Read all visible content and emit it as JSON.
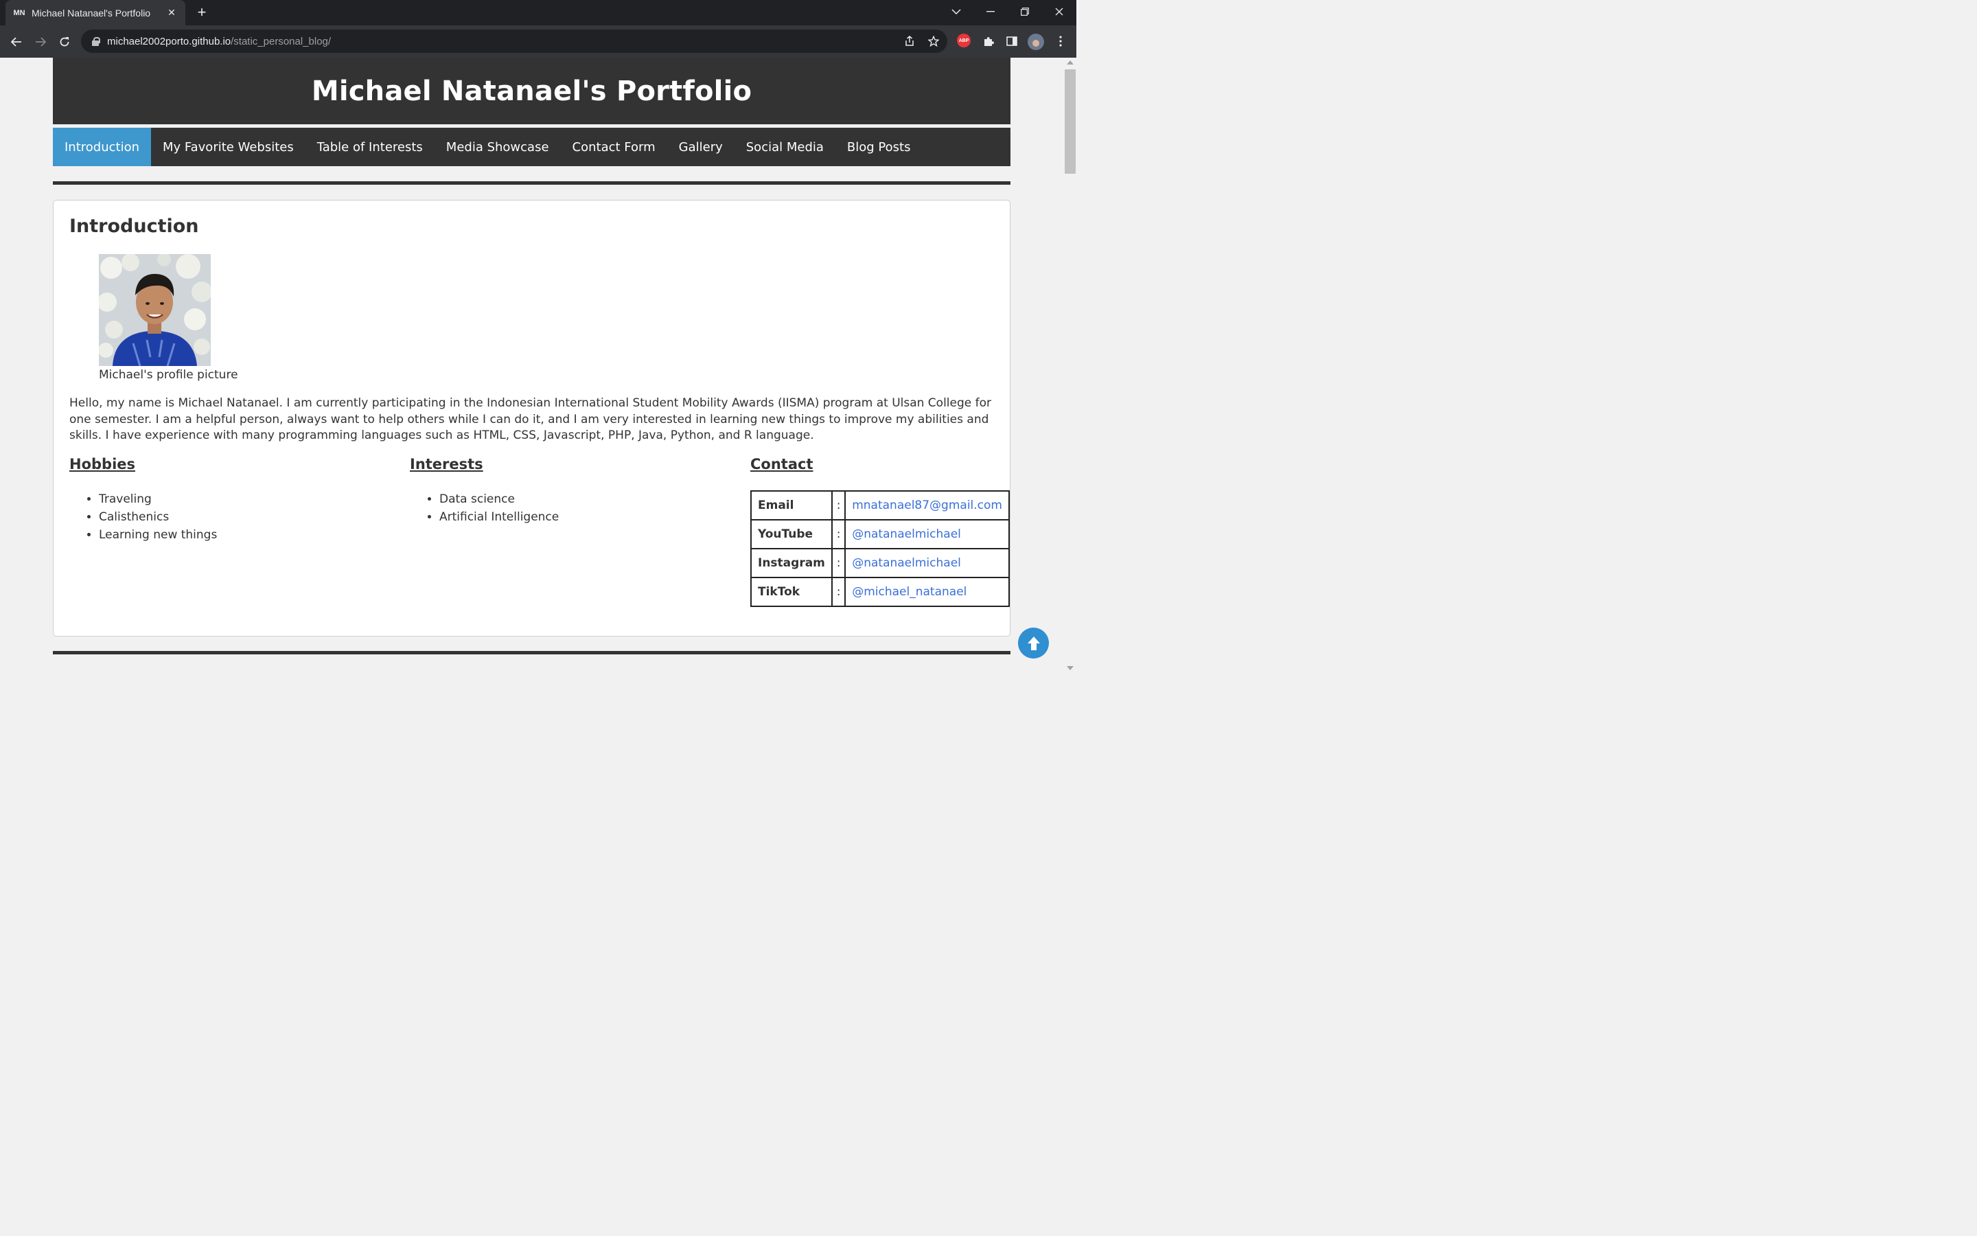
{
  "browser": {
    "tab_title": "Michael Natanael's Portfolio",
    "tab_favicon": "MN",
    "new_tab": "+",
    "close_tab": "✕",
    "url_host": "michael2002porto.github.io",
    "url_path": "/static_personal_blog/",
    "ext_abp": "ABP"
  },
  "site": {
    "title": "Michael Natanael's Portfolio",
    "nav": [
      {
        "label": "Introduction"
      },
      {
        "label": "My Favorite Websites"
      },
      {
        "label": "Table of Interests"
      },
      {
        "label": "Media Showcase"
      },
      {
        "label": "Contact Form"
      },
      {
        "label": "Gallery"
      },
      {
        "label": "Social Media"
      },
      {
        "label": "Blog Posts"
      }
    ]
  },
  "intro": {
    "heading": "Introduction",
    "caption": "Michael's profile picture",
    "bio": "Hello, my name is Michael Natanael. I am currently participating in the Indonesian International Student Mobility Awards (IISMA) program at Ulsan College for one semester. I am a helpful person, always want to help others while I can do it, and I am very interested in learning new things to improve my abilities and skills. I have experience with many programming languages such as HTML, CSS, Javascript, PHP, Java, Python, and R language.",
    "hobbies": {
      "heading": "Hobbies",
      "items": [
        "Traveling",
        "Calisthenics",
        "Learning new things"
      ]
    },
    "interests": {
      "heading": "Interests",
      "items": [
        "Data science",
        "Artificial Intelligence"
      ]
    },
    "contact": {
      "heading": "Contact",
      "rows": [
        {
          "key": "Email",
          "sep": ":",
          "value": "mnatanael87@gmail.com"
        },
        {
          "key": "YouTube",
          "sep": ":",
          "value": "@natanaelmichael"
        },
        {
          "key": "Instagram",
          "sep": ":",
          "value": "@natanaelmichael"
        },
        {
          "key": "TikTok",
          "sep": ":",
          "value": "@michael_natanael"
        }
      ]
    }
  },
  "colors": {
    "header_bg": "#333333",
    "nav_active": "#3e97cd",
    "link": "#3a6fd8",
    "back_to_top": "#2f8fd1"
  }
}
